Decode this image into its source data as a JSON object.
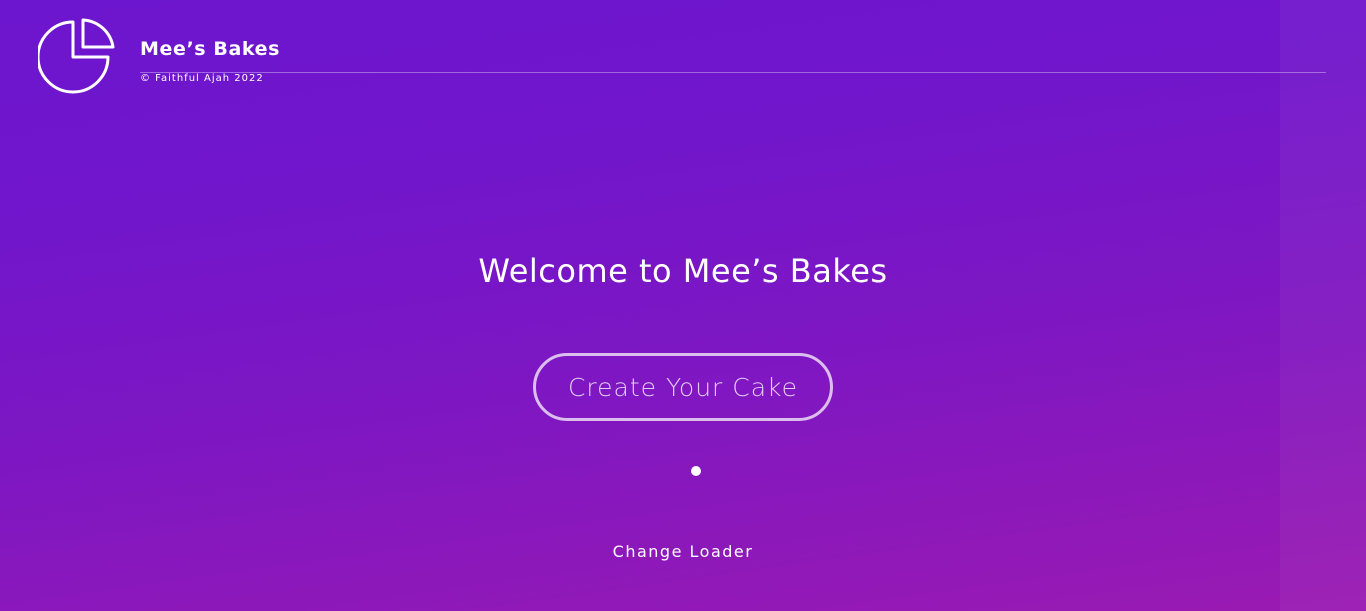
{
  "header": {
    "logo_icon": "pie-chart-icon",
    "brand_name": "Mee’s Bakes",
    "copyright": "© Faithful Ajah 2022"
  },
  "main": {
    "welcome_title": "Welcome to Mee’s Bakes",
    "cta_label": "Create Your Cake",
    "change_loader_label": "Change Loader"
  },
  "colors": {
    "background_top": "#6c16cf",
    "background_bottom": "#9a1ab2",
    "foreground": "#ffffff"
  }
}
